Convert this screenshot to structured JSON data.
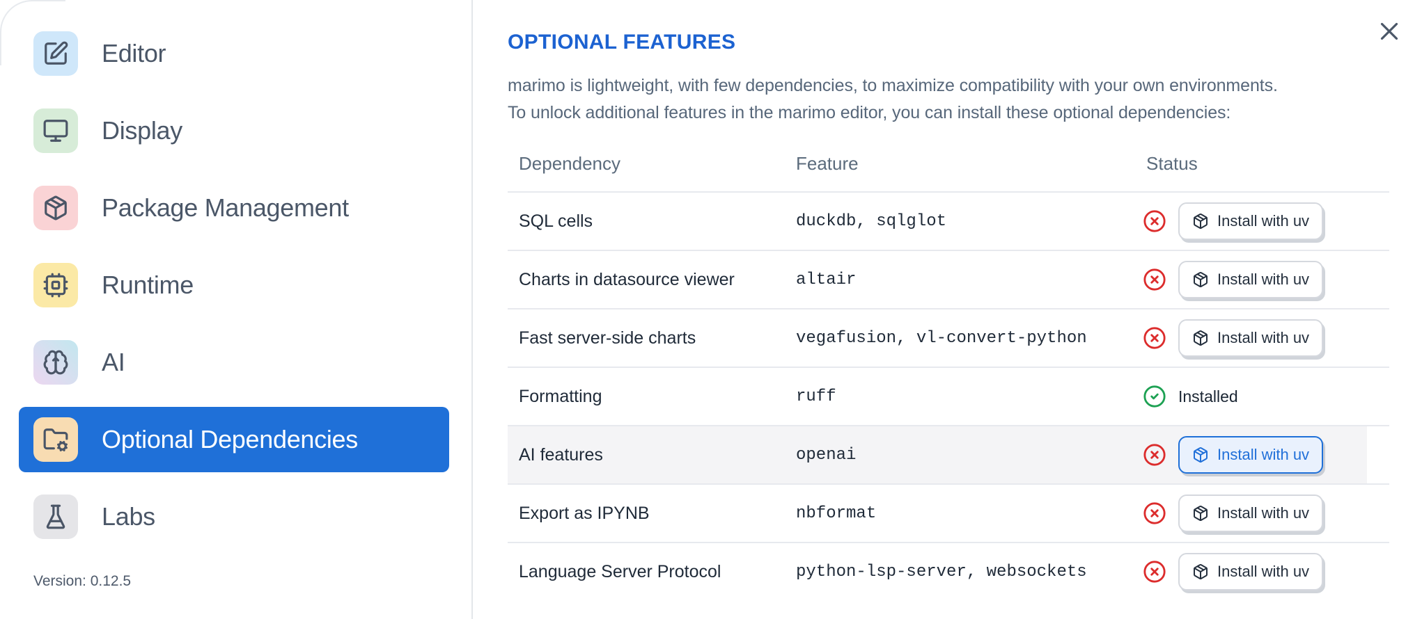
{
  "sidebar": {
    "items": [
      {
        "label": "Editor",
        "icon": "square-pen-icon",
        "tile_color": "#cfe7fa"
      },
      {
        "label": "Display",
        "icon": "monitor-icon",
        "tile_color": "#d7ecd8"
      },
      {
        "label": "Package Management",
        "icon": "package-icon",
        "tile_color": "#fad3d5"
      },
      {
        "label": "Runtime",
        "icon": "cpu-icon",
        "tile_color": "#fbe9a6"
      },
      {
        "label": "AI",
        "icon": "brain-icon",
        "tile_gradient": [
          "#ecd7f0",
          "#c2e7ef"
        ]
      },
      {
        "label": "Optional Dependencies",
        "icon": "folder-cog-icon",
        "tile_color": "#f8dcb2",
        "selected": true
      },
      {
        "label": "Labs",
        "icon": "flask-icon",
        "tile_color": "#e5e5e8"
      }
    ],
    "version_label": "Version: 0.12.5"
  },
  "dialog": {
    "title": "OPTIONAL FEATURES",
    "description_line1": "marimo is lightweight, with few dependencies, to maximize compatibility with your own environments.",
    "description_line2": "To unlock additional features in the marimo editor, you can install these optional dependencies:"
  },
  "table": {
    "headers": [
      "Dependency",
      "Feature",
      "Status"
    ],
    "install_button_label": "Install with uv",
    "installed_label": "Installed",
    "rows": [
      {
        "dependency": "SQL cells",
        "feature": "duckdb, sqlglot",
        "status": "missing"
      },
      {
        "dependency": "Charts in datasource viewer",
        "feature": "altair",
        "status": "missing"
      },
      {
        "dependency": "Fast server-side charts",
        "feature": "vegafusion, vl-convert-python",
        "status": "missing"
      },
      {
        "dependency": "Formatting",
        "feature": "ruff",
        "status": "installed"
      },
      {
        "dependency": "AI features",
        "feature": "openai",
        "status": "missing",
        "highlighted": true
      },
      {
        "dependency": "Export as IPYNB",
        "feature": "nbformat",
        "status": "missing"
      },
      {
        "dependency": "Language Server Protocol",
        "feature": "python-lsp-server, websockets",
        "status": "missing"
      }
    ]
  },
  "colors": {
    "accent_blue": "#1f70d8",
    "title_blue": "#1c62d1",
    "installed_green": "#1da153",
    "missing_red": "#dc2c2c",
    "row_highlight": "#f4f4f6"
  }
}
